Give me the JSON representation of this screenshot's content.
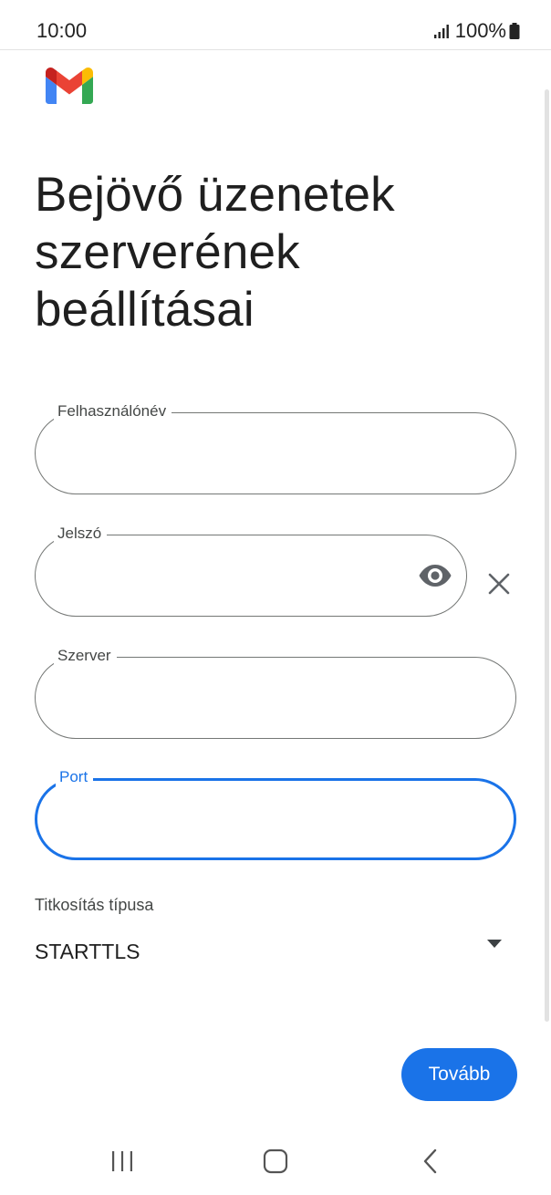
{
  "status_bar": {
    "time": "10:00",
    "battery": "100%",
    "signal_icon": "signal-bars-icon",
    "battery_icon": "battery-icon"
  },
  "app": {
    "logo": "gmail-logo",
    "logo_colors": {
      "blue": "#4285F4",
      "red": "#EA4335",
      "yellow": "#FBBC04",
      "green": "#34A853",
      "dark_red": "#C5221F"
    }
  },
  "title": {
    "lines": [
      "Bejövő üzenetek",
      "szerverének",
      "beállításai"
    ]
  },
  "form": {
    "username": {
      "label": "Felhasználónév",
      "value": ""
    },
    "password": {
      "label": "Jelszó",
      "value": "",
      "toggle_icon": "eye-icon",
      "clear_icon": "close-icon"
    },
    "server": {
      "label": "Szerver",
      "value": ""
    },
    "port": {
      "label": "Port",
      "value": "",
      "focused": true
    },
    "encryption": {
      "label": "Titkosítás típusa",
      "value": "STARTTLS",
      "dropdown_icon": "dropdown-arrow-icon"
    }
  },
  "actions": {
    "next_label": "Tovább"
  },
  "colors": {
    "accent": "#1a73e8",
    "outline": "#747775",
    "text": "#1f1f1f"
  },
  "nav": {
    "recents_icon": "recents-icon",
    "home_icon": "home-icon",
    "back_icon": "back-icon"
  }
}
